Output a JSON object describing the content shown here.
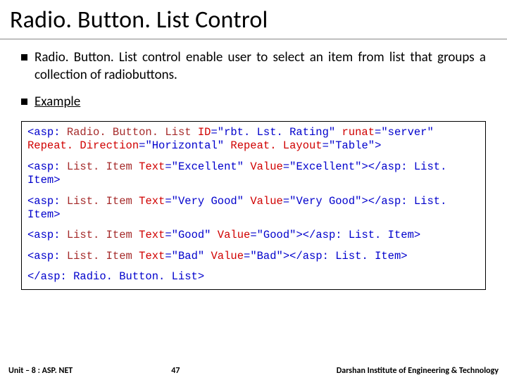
{
  "title": "Radio. Button. List Control",
  "bullets": [
    "Radio. Button. List control enable user to select an item from list that groups a collection of radiobuttons.",
    "Example"
  ],
  "code": {
    "open_tag": {
      "prefix": "<asp:",
      "name": " Radio. Button. List ",
      "attrs": [
        {
          "key": "ID",
          "val": "\"rbt. Lst. Rating\""
        },
        {
          "key": "runat",
          "val": "\"server\""
        },
        {
          "key": "Repeat. Direction",
          "val": "\"Horizontal\""
        },
        {
          "key": "Repeat. Layout",
          "val": "\"Table\"",
          "close": ">"
        }
      ]
    },
    "items": [
      {
        "text": "\"Excellent\"",
        "value": "\"Excellent\""
      },
      {
        "text": "\"Very Good\"",
        "value": "\"Very Good\""
      },
      {
        "text": "\"Good\"",
        "value": "\"Good\""
      },
      {
        "text": "\"Bad\"",
        "value": "\"Bad\""
      }
    ],
    "item_tag": {
      "open": "<asp:",
      "name": " List. Item ",
      "text_key": "Text",
      "value_key": "Value",
      "close": "></asp: List. Item>"
    },
    "close_tag": "</asp: Radio. Button. List>"
  },
  "footer": {
    "left_prefix": "Unit – 8 : ",
    "left_subject": "ASP. NET",
    "page": "47",
    "right": "Darshan Institute of Engineering & Technology"
  }
}
